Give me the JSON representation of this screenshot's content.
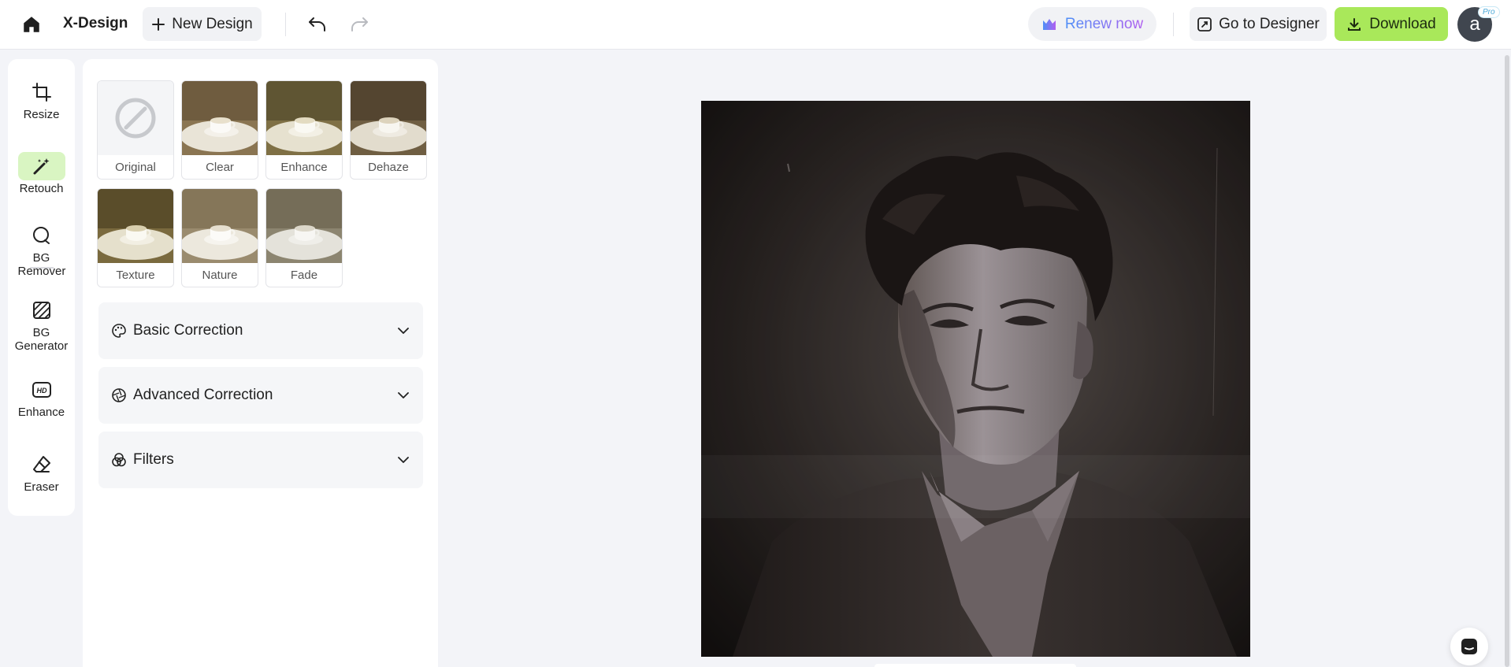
{
  "header": {
    "home_icon": "home-icon",
    "brand": "X-Design",
    "new_design_label": "New Design",
    "renew_label": "Renew now",
    "go_to_designer_label": "Go to Designer",
    "download_label": "Download",
    "avatar_letter": "a",
    "pro_badge": "Pro",
    "colors": {
      "download_bg": "#a9e85a",
      "renew_gradient_start": "#4f8ff7",
      "renew_gradient_end": "#b05ff0"
    }
  },
  "rail": {
    "items": [
      {
        "label": "Resize",
        "icon": "crop-icon"
      },
      {
        "label": "Retouch",
        "icon": "magic-wand-icon",
        "active": true
      },
      {
        "label": "BG Remover",
        "icon": "bg-remover-icon"
      },
      {
        "label": "BG Generator",
        "icon": "bg-generator-icon"
      },
      {
        "label": "Enhance",
        "icon": "hd-icon"
      },
      {
        "label": "Eraser",
        "icon": "eraser-icon"
      }
    ]
  },
  "presets": [
    {
      "label": "Original",
      "icon": "none-icon"
    },
    {
      "label": "Clear"
    },
    {
      "label": "Enhance"
    },
    {
      "label": "Dehaze"
    },
    {
      "label": "Texture"
    },
    {
      "label": "Nature"
    },
    {
      "label": "Fade"
    }
  ],
  "accordions": [
    {
      "label": "Basic Correction",
      "icon": "palette-icon"
    },
    {
      "label": "Advanced Correction",
      "icon": "aperture-icon"
    },
    {
      "label": "Filters",
      "icon": "filters-icon"
    }
  ],
  "canvas": {
    "image_description_icon": "portrait-photo"
  }
}
